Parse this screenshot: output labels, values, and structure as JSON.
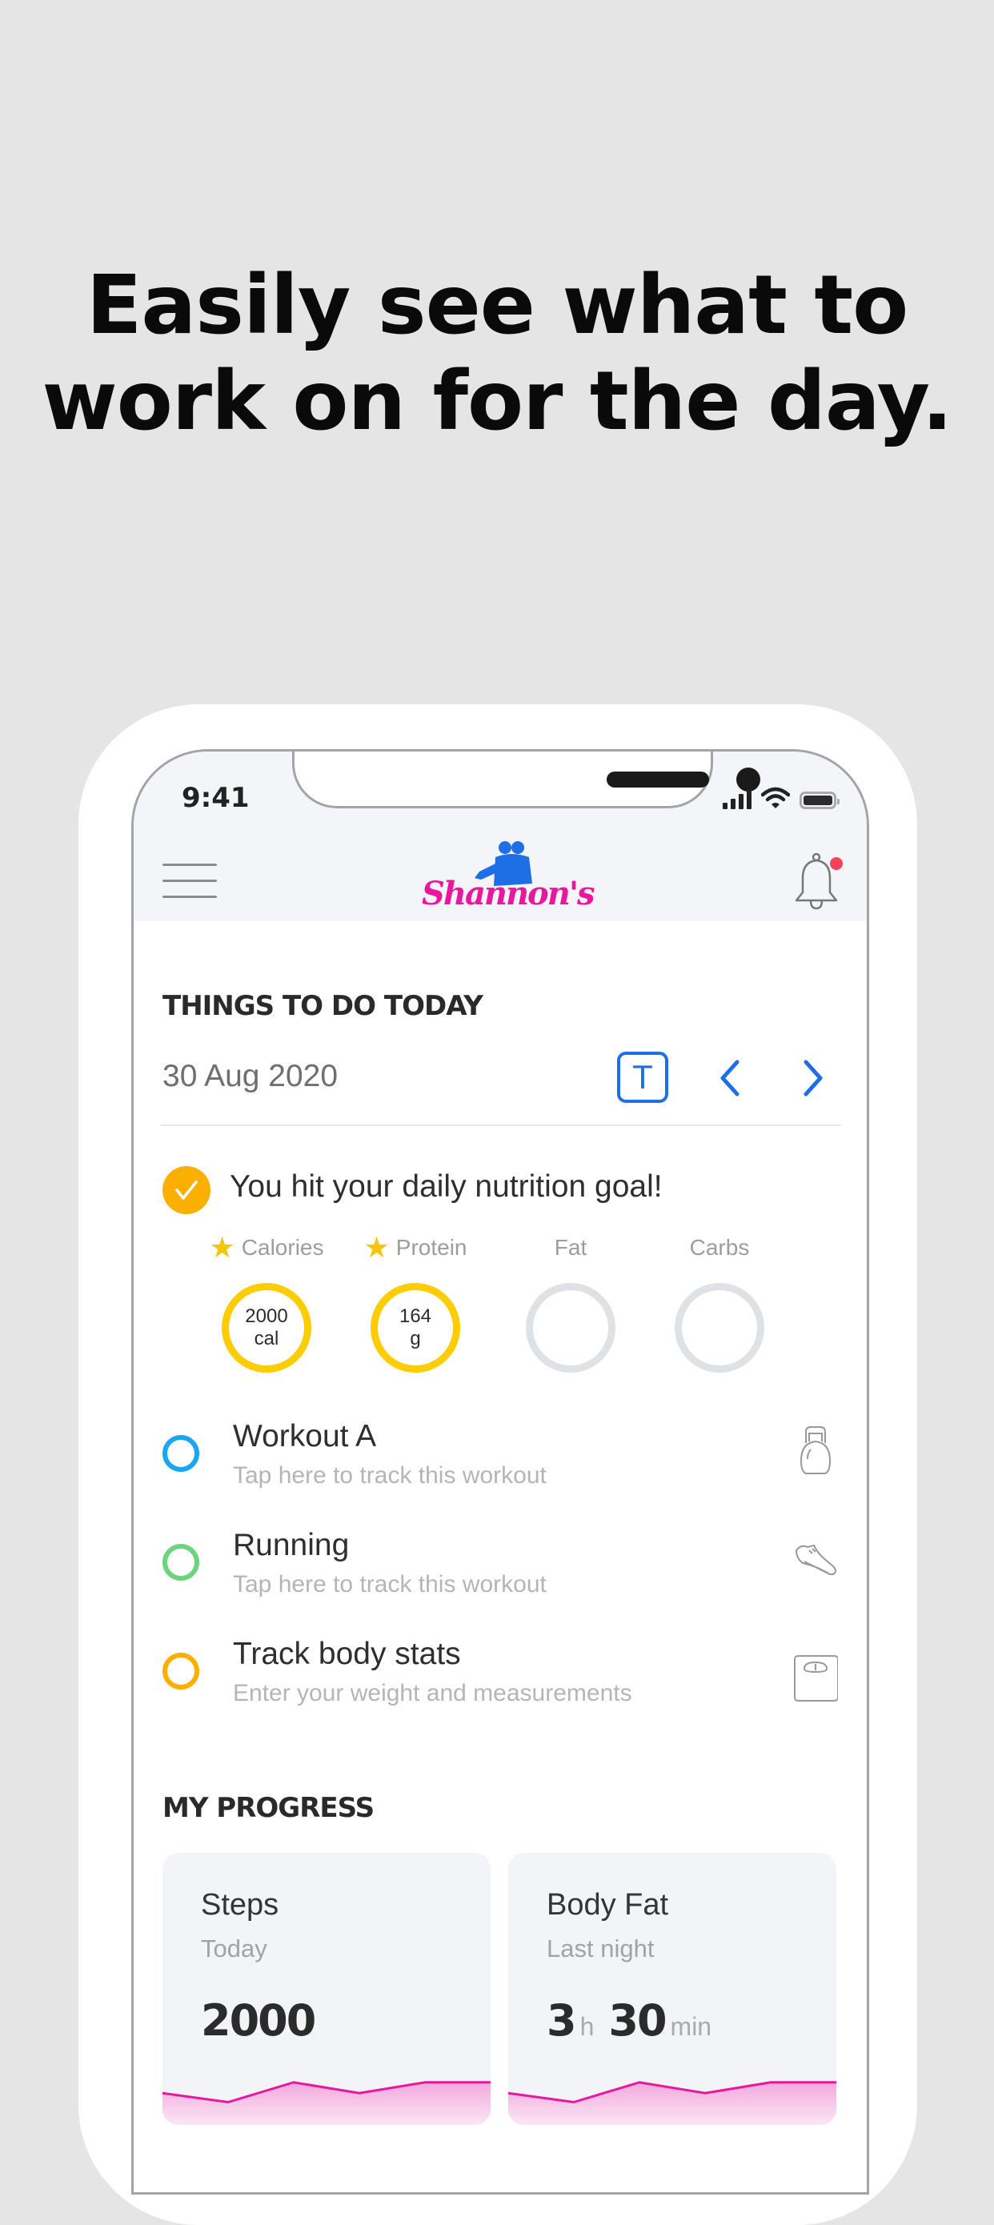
{
  "headline": {
    "line1": "Easily see what to",
    "line2": "work on for the day."
  },
  "status_bar": {
    "time": "9:41"
  },
  "header": {
    "logo_text": "Shannon's",
    "brand_pink": "#e8179e",
    "brand_blue": "#1e6fe6",
    "has_notification": true
  },
  "things_to_do": {
    "title": "THINGS TO DO TODAY",
    "date": "30 Aug 2020",
    "today_button": "T",
    "nutrition_goal": {
      "message": "You hit your daily nutrition goal!",
      "completed": true,
      "macros": [
        {
          "label": "Calories",
          "starred": true,
          "value": "2000",
          "unit": "cal",
          "hit": true
        },
        {
          "label": "Protein",
          "starred": true,
          "value": "164",
          "unit": "g",
          "hit": true
        },
        {
          "label": "Fat",
          "starred": false,
          "value": "",
          "unit": "",
          "hit": false
        },
        {
          "label": "Carbs",
          "starred": false,
          "value": "",
          "unit": "",
          "hit": false
        }
      ]
    },
    "tasks": [
      {
        "title": "Workout A",
        "subtitle": "Tap here to track this workout",
        "color": "#1aa6f0",
        "icon": "kettlebell-icon"
      },
      {
        "title": "Running",
        "subtitle": "Tap here to track this workout",
        "color": "#6dd37e",
        "icon": "running-shoe-icon"
      },
      {
        "title": "Track body stats",
        "subtitle": "Enter your weight and measurements",
        "color": "#fbb000",
        "icon": "scale-icon"
      }
    ]
  },
  "progress": {
    "title": "MY PROGRESS",
    "cards": [
      {
        "title": "Steps",
        "subtitle": "Today",
        "value": "2000",
        "trend": [
          0.55,
          0.3,
          0.85,
          0.55,
          0.85,
          0.85
        ]
      },
      {
        "title": "Body Fat",
        "subtitle": "Last night",
        "hours": "3",
        "hours_unit": "h",
        "minutes": "30",
        "minutes_unit": "min",
        "trend": [
          0.55,
          0.3,
          0.85,
          0.55,
          0.85,
          0.85
        ]
      }
    ]
  }
}
